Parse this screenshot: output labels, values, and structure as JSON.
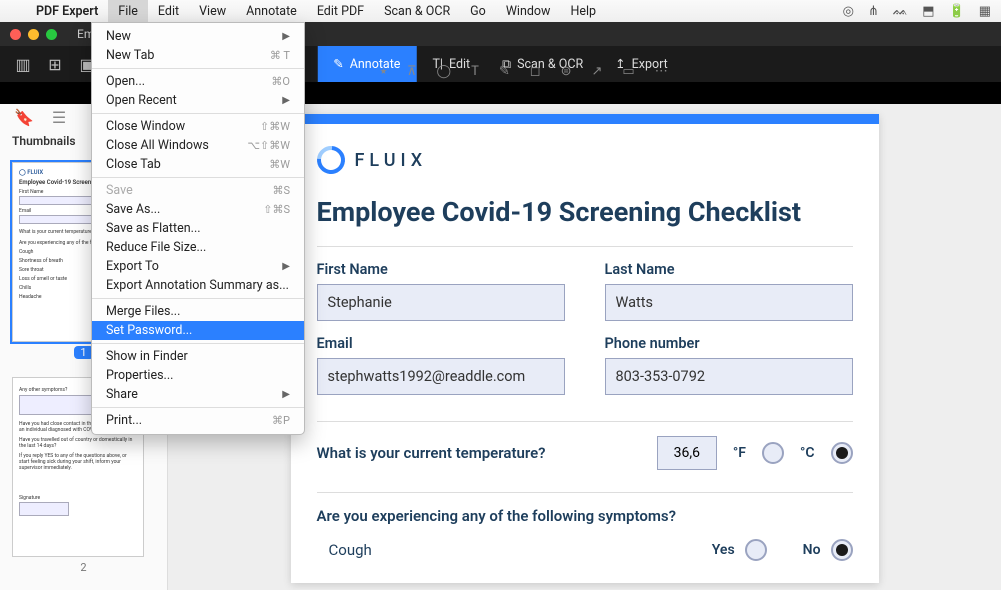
{
  "menubar": {
    "apple": "",
    "appName": "PDF Expert",
    "items": [
      "File",
      "Edit",
      "View",
      "Annotate",
      "Edit PDF",
      "Scan & OCR",
      "Go",
      "Window",
      "Help"
    ],
    "activeIndex": 0,
    "tray": [
      "◎",
      "⋔",
      "ᨐ",
      "⬒",
      "🔋",
      "▦"
    ]
  },
  "window": {
    "title": "Employ"
  },
  "maintabs": {
    "items": [
      {
        "icon": "✎",
        "label": "Annotate",
        "active": true
      },
      {
        "icon": "T|",
        "label": "Edit"
      },
      {
        "icon": "⧉",
        "label": "Scan & OCR"
      },
      {
        "icon": "↥",
        "label": "Export"
      }
    ]
  },
  "sidebar": {
    "title": "Thumbnails",
    "page1": "1",
    "page2": "2"
  },
  "doc": {
    "brand": "FLUIX",
    "title": "Employee Covid-19 Screening Checklist",
    "firstNameLabel": "First Name",
    "firstName": "Stephanie",
    "lastNameLabel": "Last Name",
    "lastName": "Watts",
    "emailLabel": "Email",
    "email": "stephwatts1992@readdle.com",
    "phoneLabel": "Phone number",
    "phone": "803-353-0792",
    "tempQuestion": "What is your current temperature?",
    "tempValue": "36,6",
    "unitF": "°F",
    "unitC": "°C",
    "symptomQuestion": "Are you experiencing any of the following symptoms?",
    "symptom1": "Cough",
    "yes": "Yes",
    "no": "No"
  },
  "dropdown": {
    "groups": [
      [
        {
          "label": "New",
          "arrow": true
        },
        {
          "label": "New Tab",
          "sc": "⌘ T"
        }
      ],
      [
        {
          "label": "Open...",
          "sc": "⌘O"
        },
        {
          "label": "Open Recent",
          "arrow": true
        }
      ],
      [
        {
          "label": "Close Window",
          "sc": "⇧⌘W"
        },
        {
          "label": "Close All Windows",
          "sc": "⌥⇧⌘W"
        },
        {
          "label": "Close Tab",
          "sc": "⌘W"
        }
      ],
      [
        {
          "label": "Save",
          "sc": "⌘S",
          "disabled": true
        },
        {
          "label": "Save As...",
          "sc": "⇧⌘S"
        },
        {
          "label": "Save as Flatten..."
        },
        {
          "label": "Reduce File Size..."
        },
        {
          "label": "Export To",
          "arrow": true
        },
        {
          "label": "Export Annotation Summary as..."
        }
      ],
      [
        {
          "label": "Merge Files..."
        },
        {
          "label": "Set Password...",
          "selected": true
        }
      ],
      [
        {
          "label": "Show in Finder"
        },
        {
          "label": "Properties..."
        },
        {
          "label": "Share",
          "arrow": true
        }
      ],
      [
        {
          "label": "Print...",
          "sc": "⌘P"
        }
      ]
    ]
  }
}
